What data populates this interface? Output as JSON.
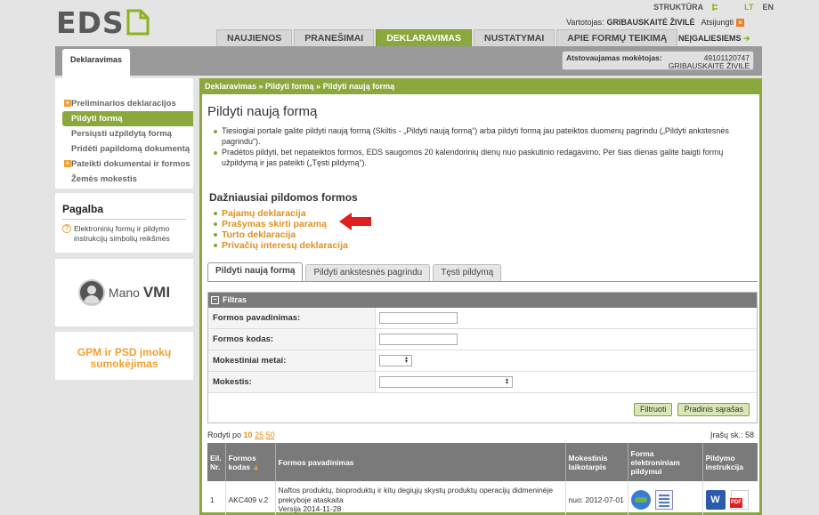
{
  "header": {
    "logo": "EDS",
    "structure_link": "STRUKTŪRA",
    "languages": [
      "LT",
      "EN"
    ],
    "user_label": "Vartotojas:",
    "user_name": "GRIBAUSKAITĖ ŽIVILĖ",
    "logout": "Atsijungti",
    "disabled_link": "NEĮGALIESIEMS"
  },
  "nav": {
    "tabs": [
      {
        "label": "NAUJIENOS"
      },
      {
        "label": "PRANEŠIMAI"
      },
      {
        "label": "DEKLARAVIMAS"
      },
      {
        "label": "NUSTATYMAI"
      },
      {
        "label": "APIE FORMŲ TEIKIMĄ"
      }
    ],
    "active_tab": "DEKLARAVIMAS"
  },
  "section_tab": "Deklaravimas",
  "taxpayer": {
    "label": "Atstovaujamas mokėtojas:",
    "code": "49101120747",
    "name": "GRIBAUSKAITĖ ŽIVILĖ"
  },
  "sidebar": {
    "items": [
      {
        "label": "Preliminarios deklaracijos"
      },
      {
        "label": "Pildyti formą"
      },
      {
        "label": "Persiųsti užpildytą formą"
      },
      {
        "label": "Pridėti papildomą dokumentą"
      },
      {
        "label": "Pateikti dokumentai ir formos"
      },
      {
        "label": "Žemės mokestis"
      }
    ],
    "help_title": "Pagalba",
    "help_text": "Elektroninių formų ir pildymo instrukcijų simbolių reikšmės",
    "vmi_prefix": "Mano",
    "vmi_brand": "VMI",
    "gpm_text": "GPM ir PSD įmokų sumokėjimas"
  },
  "main": {
    "breadcrumb": "Deklaravimas » Pildyti formą » Pildyti naują formą",
    "title": "Pildyti naują formą",
    "intro": [
      "Tiesiogiai portale galite pildyti naują formą (Skiltis - „Pildyti naują formą“) arba pildyti formą jau pateiktos duomenų pagrindu („Pildyti ankstesnės pagrindu“).",
      "Pradėtos pildyti, bet nepateiktos formos, EDS saugomos 20 kalendorinių dienų nuo paskutinio redagavimo. Per šias dienas galite baigti formų užpildymą ir jas pateikti („Tęsti pildymą“)."
    ],
    "freq_title": "Dažniausiai pildomos formos",
    "freq_forms": [
      {
        "label": "Pajamų deklaracija"
      },
      {
        "label": "Prašymas skirti paramą"
      },
      {
        "label": "Turto deklaracija"
      },
      {
        "label": "Privačių interesų deklaracija"
      }
    ],
    "form_tabs": [
      {
        "label": "Pildyti naują formą"
      },
      {
        "label": "Pildyti ankstesnės pagrindu"
      },
      {
        "label": "Tęsti pildymą"
      }
    ],
    "filter": {
      "title": "Filtras",
      "fields": [
        {
          "label": "Formos pavadinimas:"
        },
        {
          "label": "Formos kodas:"
        },
        {
          "label": "Mokestiniai metai:"
        },
        {
          "label": "Mokestis:"
        }
      ],
      "filter_button": "Filtruoti",
      "reset_button": "Pradinis sąrašas"
    },
    "paging": {
      "label": "Rodyti po",
      "options": [
        "10",
        "25",
        "50"
      ],
      "current": "10",
      "records_label": "Įrašų sk.: 58"
    },
    "table": {
      "headers": [
        "Eil. Nr.",
        "Formos kodas",
        "Formos pavadinimas",
        "Mokestinis laikotarpis",
        "Forma elektroniniam pildymui",
        "Pildymo instrukcija"
      ],
      "rows": [
        {
          "nr": "1",
          "code": "AKC409 v.2",
          "name": "Naftos produktų, bioproduktų ir kitų degiųjų skystų produktų operacijų didmeninėje prekyboje ataskaita",
          "version": "Versija 2014-11-28",
          "period": "nuo: 2012-07-01"
        }
      ]
    }
  }
}
